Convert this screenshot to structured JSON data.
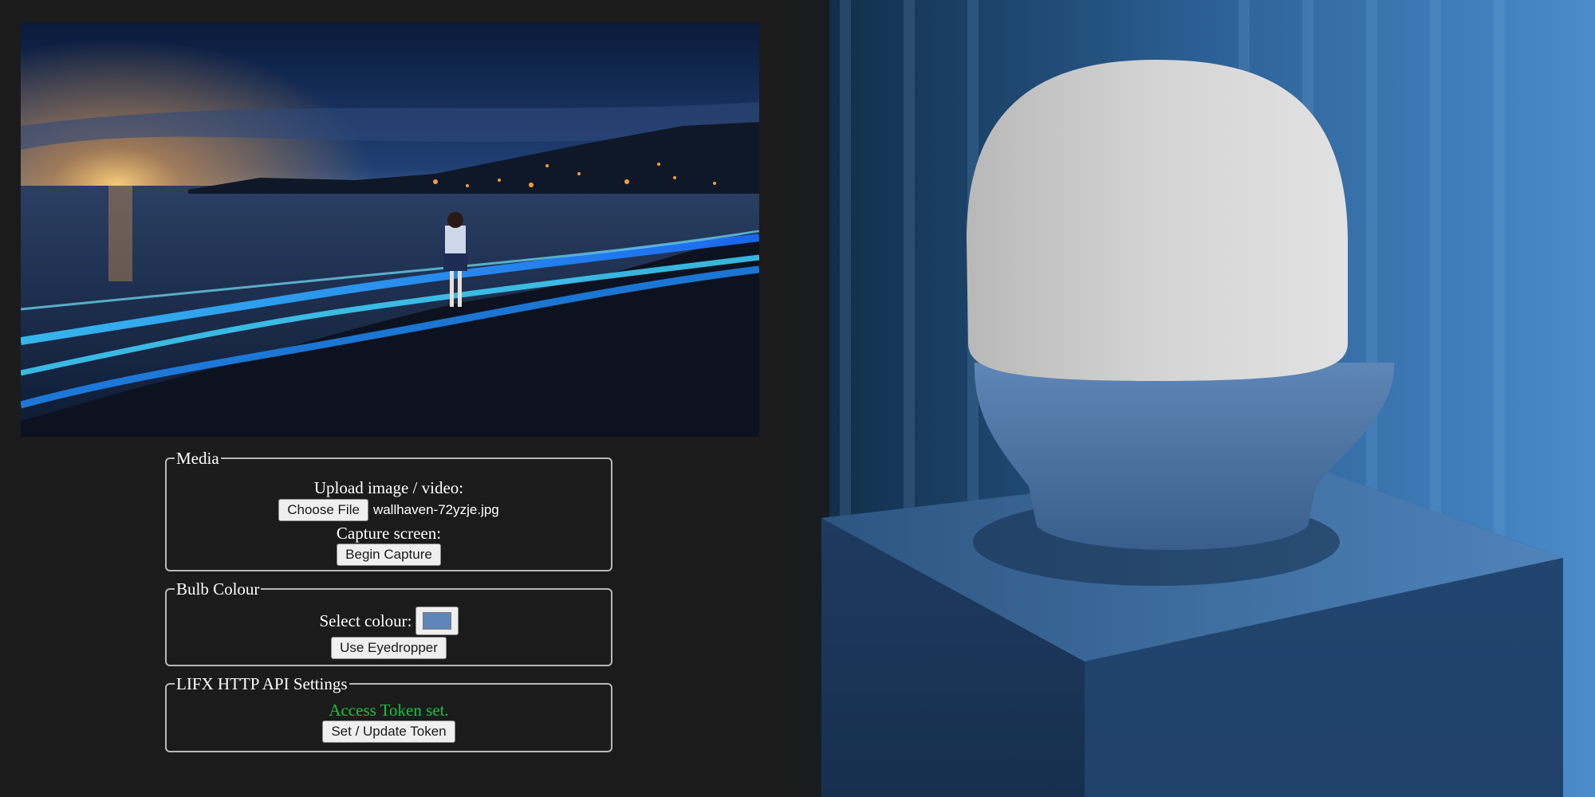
{
  "media": {
    "legend": "Media",
    "upload_label": "Upload image / video:",
    "choose_file_label": "Choose File",
    "file_name": "wallhaven-72yzje.jpg",
    "capture_label": "Capture screen:",
    "begin_capture_label": "Begin Capture"
  },
  "bulb": {
    "legend": "Bulb Colour",
    "select_label": "Select colour:",
    "selected_colour": "#5f86b9",
    "eyedropper_label": "Use Eyedropper"
  },
  "lifx": {
    "legend": "LIFX HTTP API Settings",
    "status_text": "Access Token set.",
    "status_color": "#19c33f",
    "set_token_label": "Set / Update Token"
  },
  "colors": {
    "page_background": "#1b1b1b",
    "panel_border": "#b8b8b8"
  }
}
